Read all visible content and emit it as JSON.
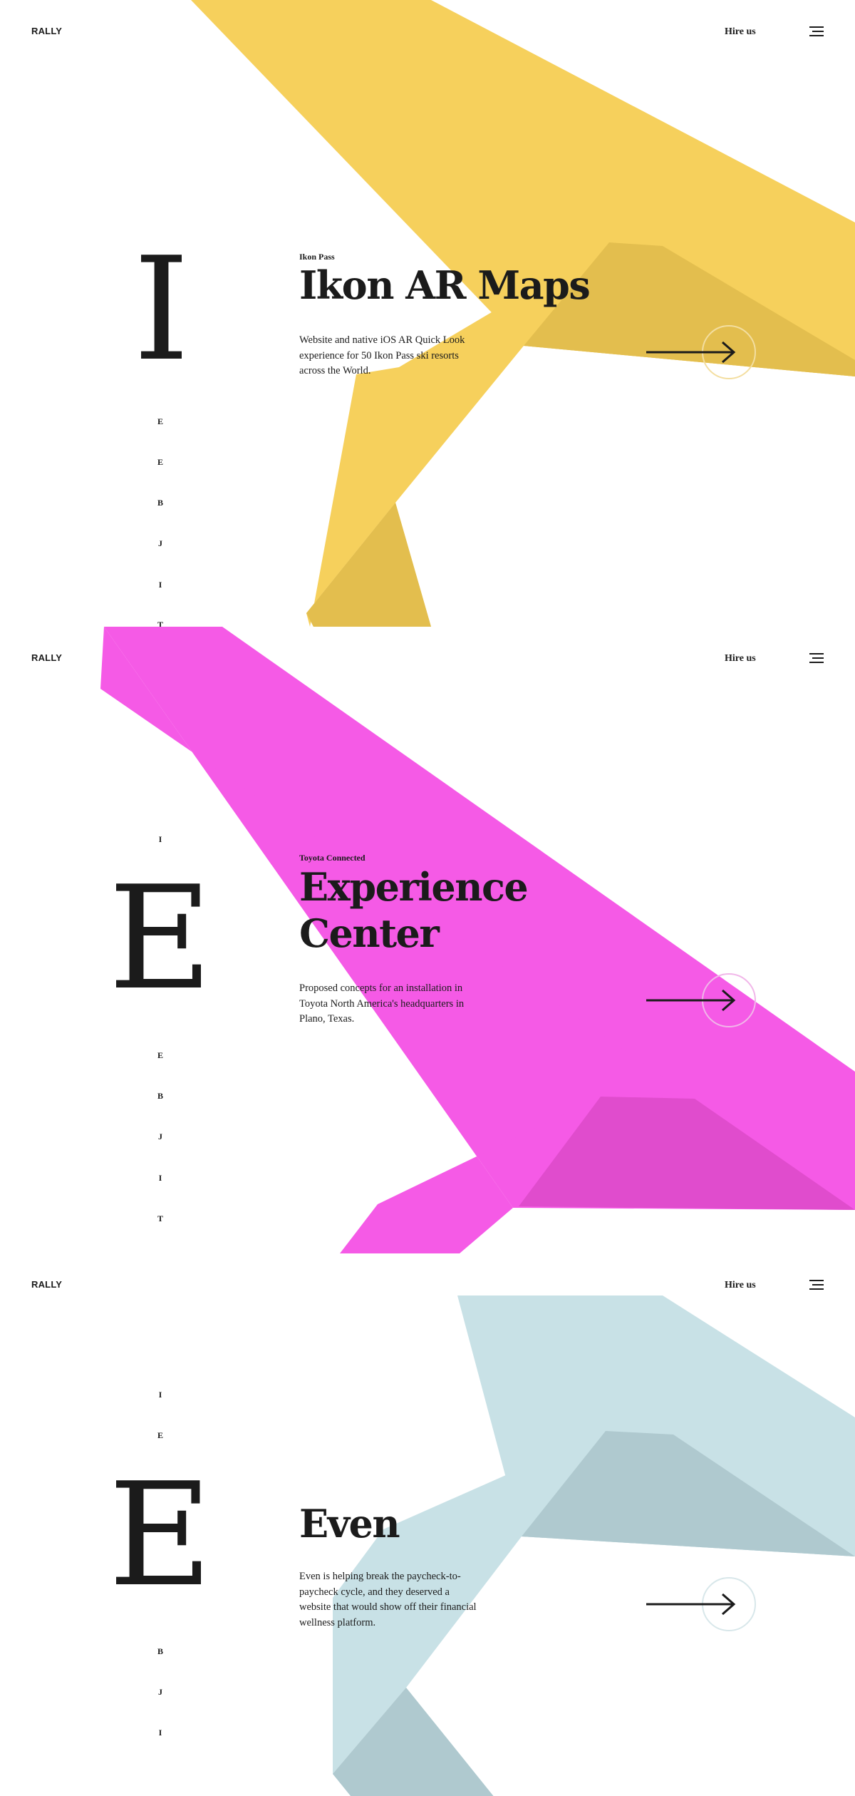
{
  "header": {
    "logo": "RALLY",
    "hire_label": "Hire us",
    "menu_icon": "hamburger-menu-icon"
  },
  "projects": [
    {
      "big_letter": "I",
      "vertical_letters": [
        "E",
        "E",
        "B",
        "J",
        "I",
        "T"
      ],
      "eyebrow": "Ikon Pass",
      "title_line1": "Ikon AR Maps",
      "title_line2": "",
      "description_lines": [
        "Website and native iOS AR Quick Look",
        "experience for 50 Ikon Pass ski resorts",
        "across the World."
      ],
      "colors": {
        "ribbon": "#f6d05c",
        "shade": "#e3be4e",
        "circle": "#f3dea0"
      },
      "arrow_icon": "arrow-right-icon"
    },
    {
      "big_letter": "E",
      "vertical_letters": [
        "I",
        "E",
        "B",
        "J",
        "I",
        "T"
      ],
      "eyebrow": "Toyota Connected",
      "title_line1": "Experience",
      "title_line2": "Center",
      "description_lines": [
        "Proposed concepts for an installation in",
        "Toyota North America's headquarters in",
        "Plano, Texas."
      ],
      "colors": {
        "ribbon": "#f55ae6",
        "shade": "#e04ccd",
        "circle": "#f1b6e9"
      },
      "arrow_icon": "arrow-right-icon"
    },
    {
      "big_letter": "E",
      "vertical_letters": [
        "I",
        "E",
        "B",
        "J",
        "I"
      ],
      "eyebrow": "",
      "title_line1": "Even",
      "title_line2": "",
      "description_lines": [
        "Even is helping break the paycheck-to-",
        "paycheck cycle, and they deserved a",
        "website that would show off their financial",
        "wellness platform."
      ],
      "colors": {
        "ribbon": "#c8e1e6",
        "shade": "#afc9cf",
        "circle": "#d8e7ea"
      },
      "arrow_icon": "arrow-right-icon"
    }
  ]
}
